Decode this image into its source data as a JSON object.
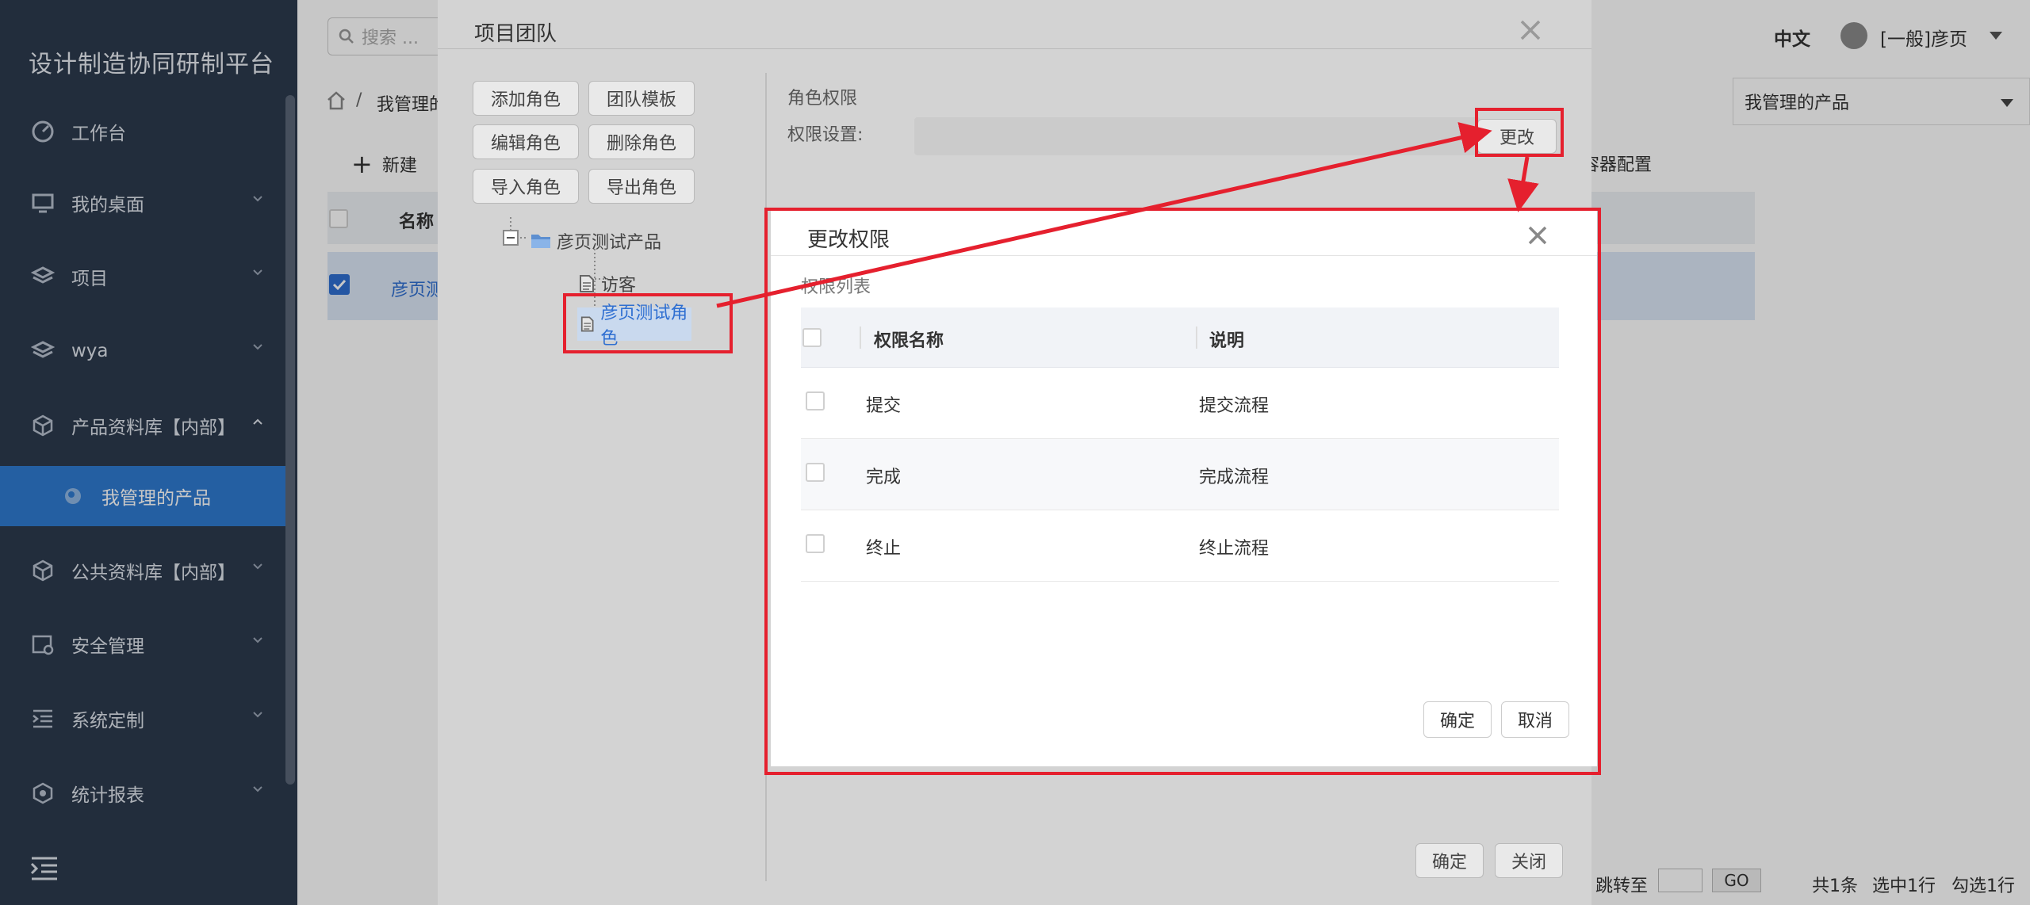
{
  "app": {
    "title": "设计制造协同研制平台",
    "search_placeholder": "搜索 ...",
    "language": "中文",
    "user": "[一般]彦页"
  },
  "sidebar": {
    "items": [
      {
        "label": "工作台",
        "icon": "dashboard-icon"
      },
      {
        "label": "我的桌面",
        "icon": "monitor-icon"
      },
      {
        "label": "项目",
        "icon": "layers-icon"
      },
      {
        "label": "wya",
        "icon": "layers-icon"
      },
      {
        "label": "产品资料库【内部】",
        "icon": "cube-icon"
      },
      {
        "label": "我管理的产品",
        "icon": "circle-icon"
      },
      {
        "label": "公共资料库【内部】",
        "icon": "cube-icon"
      },
      {
        "label": "安全管理",
        "icon": "shield-gear-icon"
      },
      {
        "label": "系统定制",
        "icon": "indent-icon"
      },
      {
        "label": "统计报表",
        "icon": "hexagon-icon"
      }
    ],
    "collapse_icon": "indent-icon"
  },
  "page": {
    "breadcrumb": "我管理的",
    "dropdown_value": "我管理的产品",
    "new_label": "新建",
    "column_name": "名称",
    "row_name": "彦页测",
    "partial_tab": "容器配置",
    "pager": {
      "jump_label": "跳转至",
      "go": "GO",
      "total": "共1条",
      "selected_row": "选中1行",
      "checked_row": "勾选1行"
    }
  },
  "team_dialog": {
    "title": "项目团队",
    "buttons": [
      "添加角色",
      "团队模板",
      "编辑角色",
      "删除角色",
      "导入角色",
      "导出角色"
    ],
    "tree": {
      "root": "彦页测试产品",
      "children": [
        "访客",
        "彦页测试角色"
      ]
    },
    "role_permission_label": "角色权限",
    "permission_setting_label": "权限设置:",
    "change_button": "更改",
    "ok_button": "确定",
    "close_button": "关闭"
  },
  "perm_dialog": {
    "title": "更改权限",
    "list_label": "权限列表",
    "columns": [
      "权限名称",
      "说明"
    ],
    "rows": [
      {
        "name": "提交",
        "desc": "提交流程"
      },
      {
        "name": "完成",
        "desc": "完成流程"
      },
      {
        "name": "终止",
        "desc": "终止流程"
      }
    ],
    "ok_button": "确定",
    "cancel_button": "取消"
  },
  "colors": {
    "sidebar_bg": "#2c3a4e",
    "sidebar_active": "#2f7ad0",
    "annotation_red": "#e5202e",
    "link_blue": "#2f6fd1"
  }
}
